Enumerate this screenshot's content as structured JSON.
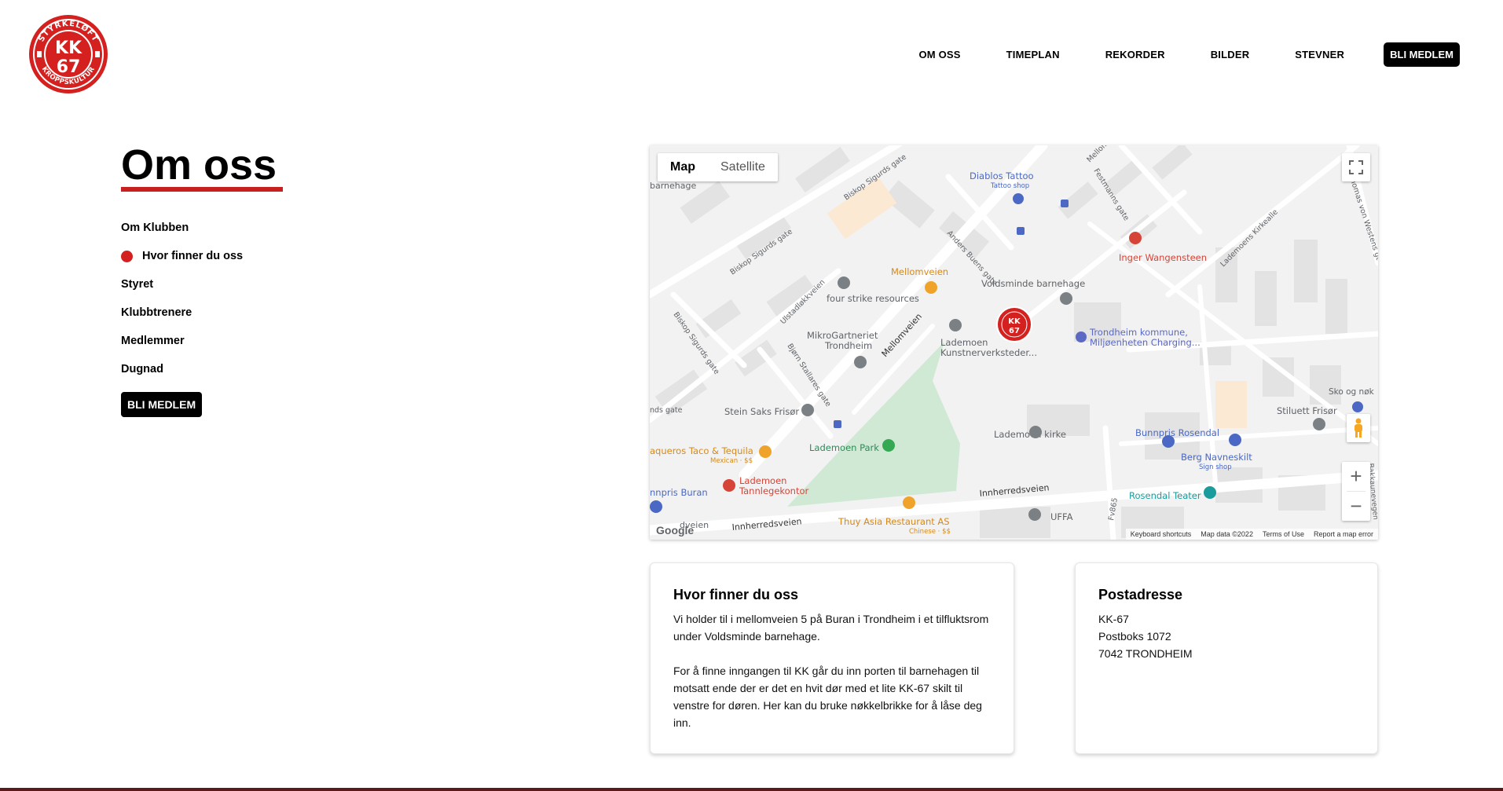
{
  "logo": {
    "top_text": "STYRKELØFT",
    "main": "KK",
    "number": "67",
    "bottom_text": "KROPPSKULTUR"
  },
  "nav": {
    "items": [
      "OM OSS",
      "TIMEPLAN",
      "REKORDER",
      "BILDER",
      "STEVNER"
    ],
    "cta": "BLI MEDLEM"
  },
  "page": {
    "title": "Om oss",
    "accent_color": "#c8201e"
  },
  "side_nav": {
    "items": [
      {
        "label": "Om Klubben",
        "active": false
      },
      {
        "label": "Hvor finner du oss",
        "active": true
      },
      {
        "label": "Styret",
        "active": false
      },
      {
        "label": "Klubbtrenere",
        "active": false
      },
      {
        "label": "Medlemmer",
        "active": false
      },
      {
        "label": "Dugnad",
        "active": false
      }
    ],
    "cta": "BLI MEDLEM"
  },
  "map": {
    "type_map": "Map",
    "type_satellite": "Satellite",
    "google": "Google",
    "footer": [
      "Keyboard shortcuts",
      "Map data ©2022",
      "Terms of Use",
      "Report a map error"
    ],
    "labels": {
      "barnehage": "barnehage",
      "biskop1": "Biskop Sigurds gate",
      "biskop2": "Biskop Sigurds gate",
      "biskop3": "Biskop Sigurds gate",
      "diablos": "Diablos Tattoo",
      "diablos_sub": "Tattoo shop",
      "anders": "Anders Buens gate",
      "festmanns": "Festmanns gate",
      "mellomv_top": "Mellomv",
      "thomas": "Thomas von Westens gt",
      "kirkealle": "Lademoens Kirkealle",
      "inger": "Inger Wangensteen",
      "mellomveien_poi": "Mellomveien",
      "voldsminde": "Voldsminde barnehage",
      "ulstad": "Ulstadløkkveien",
      "fourstrike": "four strike resources",
      "mikro1": "MikroGartneriet",
      "mikro2": "Trondheim",
      "mellomveien_road": "Mellomveien",
      "lademoen_kunst1": "Lademoen",
      "lademoen_kunst2": "Kunstnerverksteder...",
      "kommune1": "Trondheim kommune,",
      "kommune2": "Miljøenheten Charging...",
      "bjorn": "Bjørn Stallares gate",
      "sko": "Sko og nøk",
      "nds": "nds gate",
      "steinsaks": "Stein Saks Frisør",
      "stilett": "Stiluett Frisør",
      "kirke": "Lademoen kirke",
      "park": "Lademoen Park",
      "bunnpris_ros": "Bunnpris Rosendal",
      "berg": "Berg Navneskilt",
      "berg_sub": "Sign shop",
      "taqueros": "aqueros Taco & Tequila",
      "taqueros_sub": "Mexican · $$",
      "tann1": "Lademoen",
      "tann2": "Tannlegekontor",
      "bunnpris_buran": "nnpris Buran",
      "innherred1": "Innherredsveien",
      "innherred2": "Innherredsveien",
      "fv865": "Fv865",
      "rosendal": "Rosendal Teater",
      "bakkaune": "Bakkaunevegen",
      "thuy": "Thuy Asia Restaurant AS",
      "thuy_sub": "Chinese · $$",
      "uffa": "UFFA",
      "dveien": "dveien",
      "kk": "KK",
      "kk_num": "67"
    }
  },
  "card_location": {
    "title": "Hvor finner du oss",
    "p1": "Vi holder til i mellomveien 5 på Buran i Trondheim i et tilfluktsrom under Voldsminde barnehage.",
    "p2": "For å finne inngangen til KK går du inn porten til barnehagen til motsatt ende der er det en hvit dør med et lite KK-67 skilt til venstre for døren. Her kan du bruke nøkkelbrikke for å låse deg inn."
  },
  "card_post": {
    "title": "Postadresse",
    "line1": "KK-67",
    "line2": "Postboks 1072",
    "line3": "7042 TRONDHEIM"
  }
}
